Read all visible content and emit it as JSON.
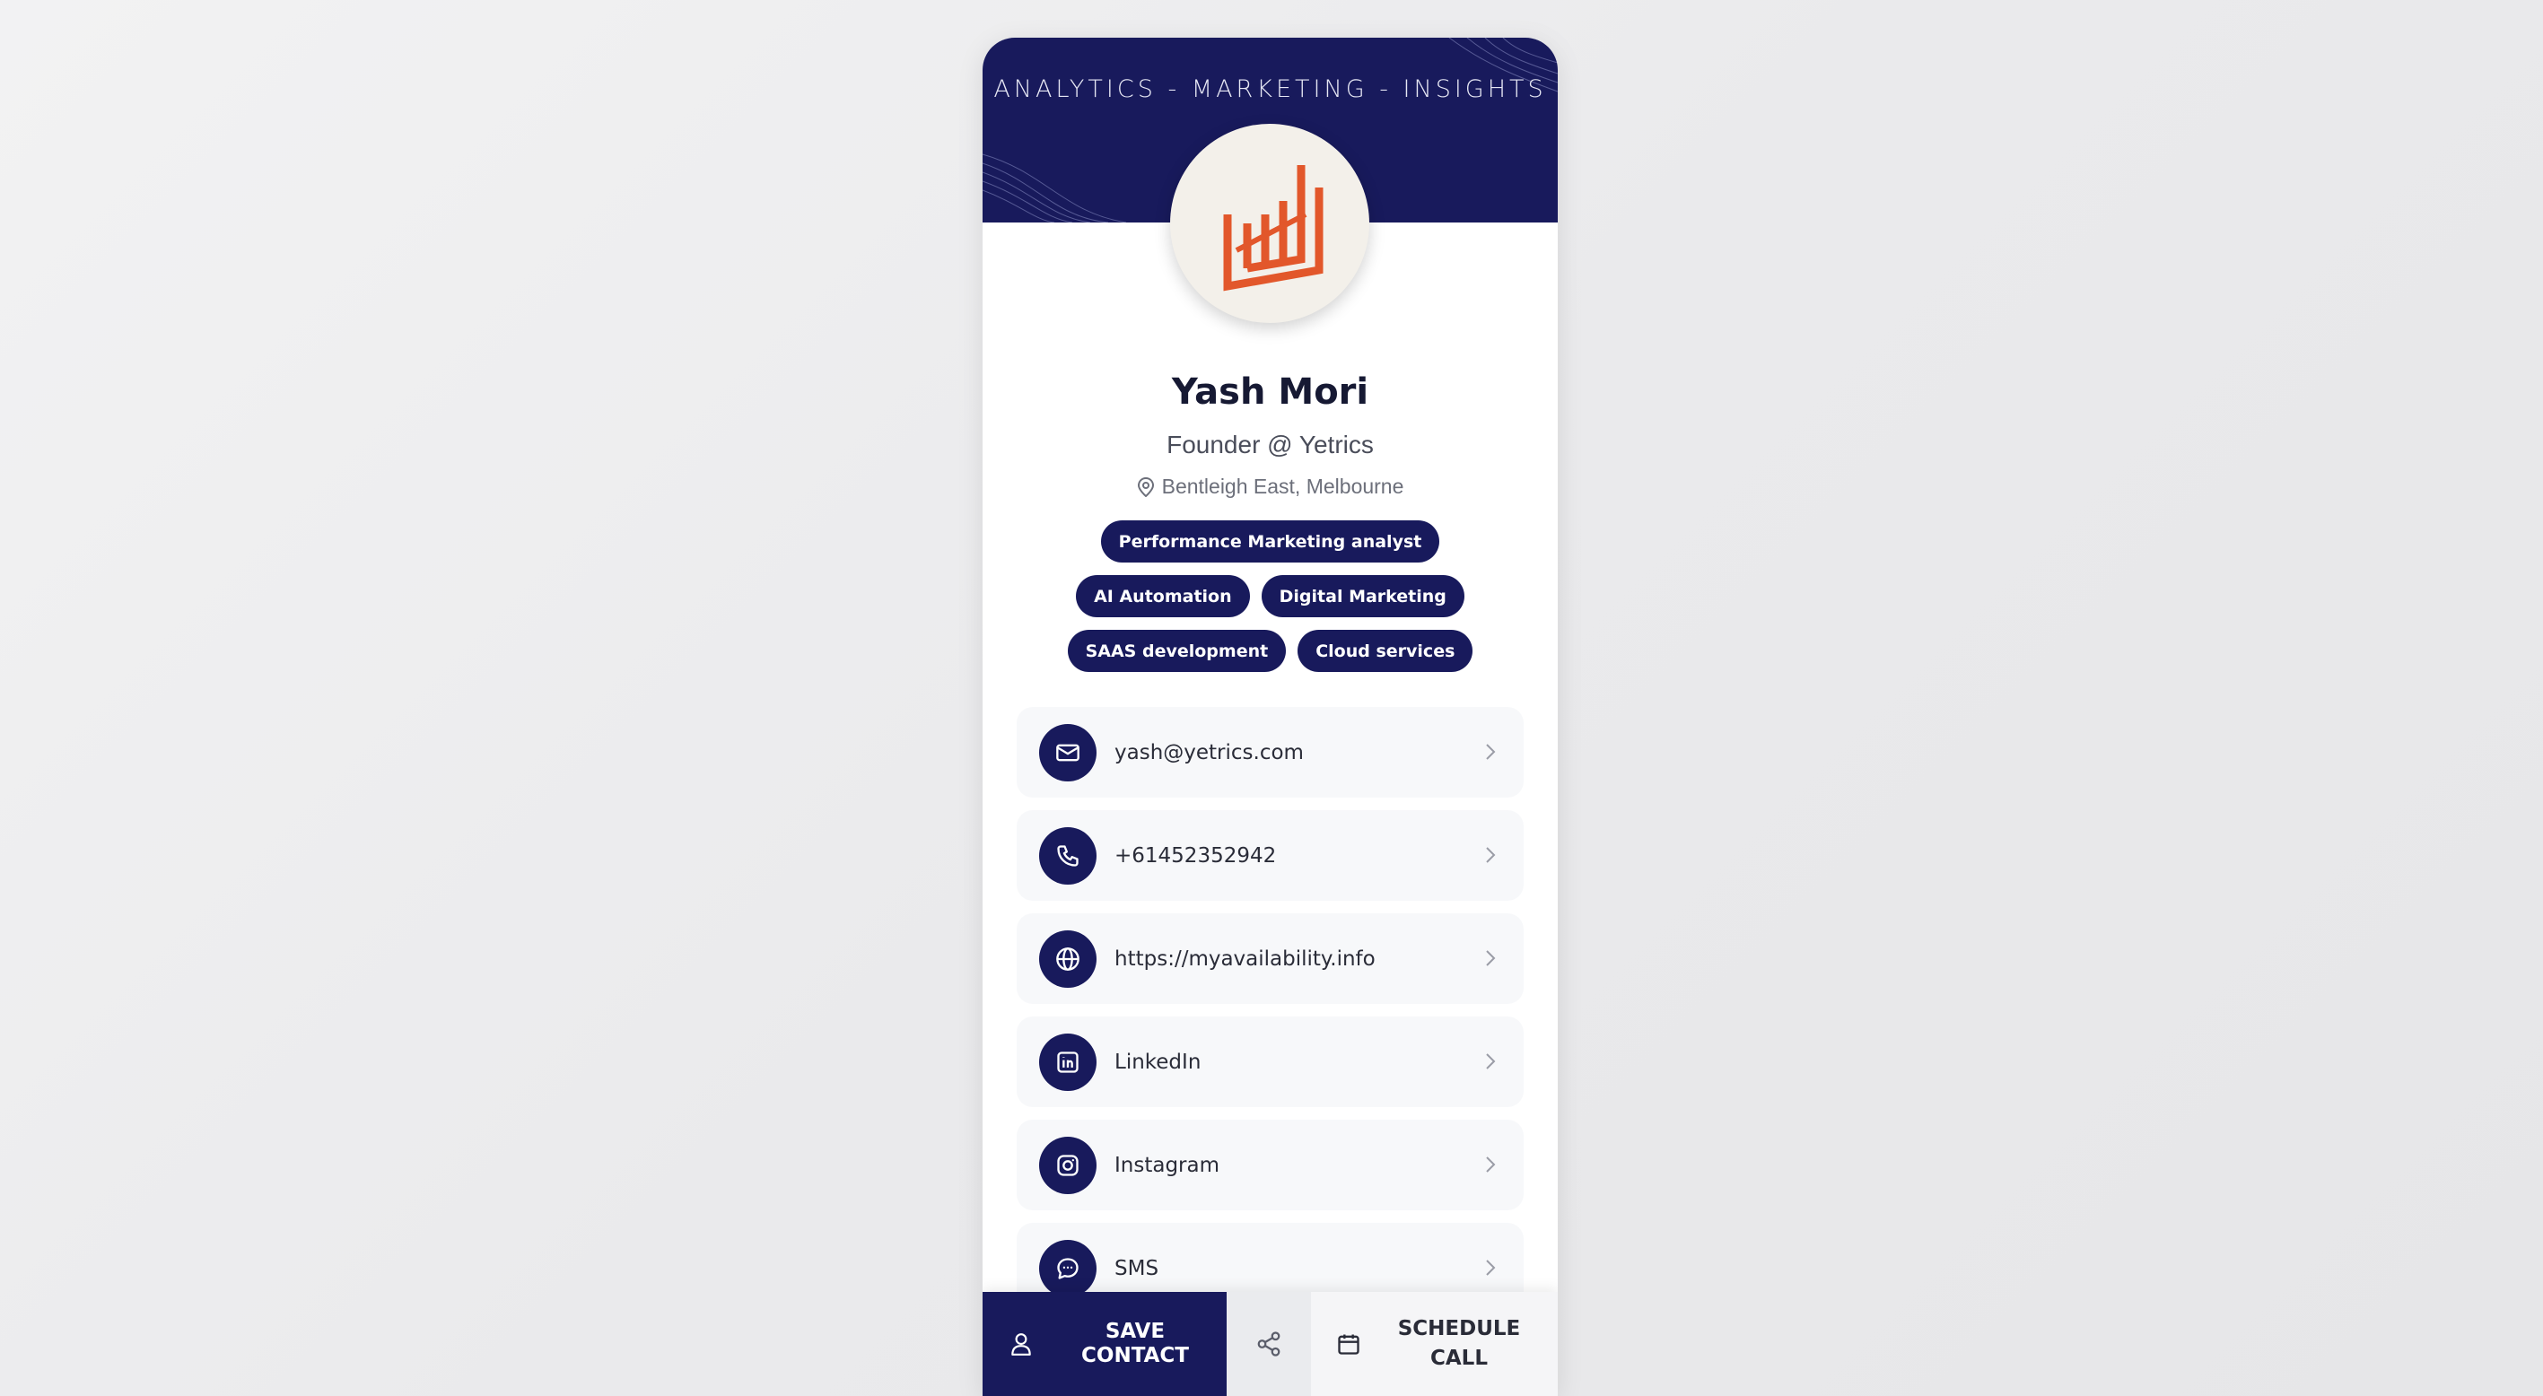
{
  "banner": {
    "tagline": "ANALYTICS  -  MARKETING  -  INSIGHTS"
  },
  "profile": {
    "name": "Yash Mori",
    "role": "Founder @ Yetrics",
    "location": "Bentleigh East, Melbourne"
  },
  "tags": [
    "Performance Marketing analyst",
    "AI Automation",
    "Digital Marketing",
    "SAAS development",
    "Cloud services"
  ],
  "contacts": [
    {
      "label": "yash@yetrics.com",
      "icon": "mail-icon"
    },
    {
      "label": "+61452352942",
      "icon": "phone-icon"
    },
    {
      "label": "https://myavailability.info",
      "icon": "globe-icon"
    },
    {
      "label": "LinkedIn",
      "icon": "linkedin-icon"
    },
    {
      "label": "Instagram",
      "icon": "instagram-icon"
    },
    {
      "label": "SMS",
      "icon": "message-icon"
    }
  ],
  "actions": {
    "save_label": "SAVE CONTACT",
    "schedule_label": "SCHEDULE CALL"
  },
  "colors": {
    "brand": "#181a5c",
    "logo": "#e2572b"
  }
}
